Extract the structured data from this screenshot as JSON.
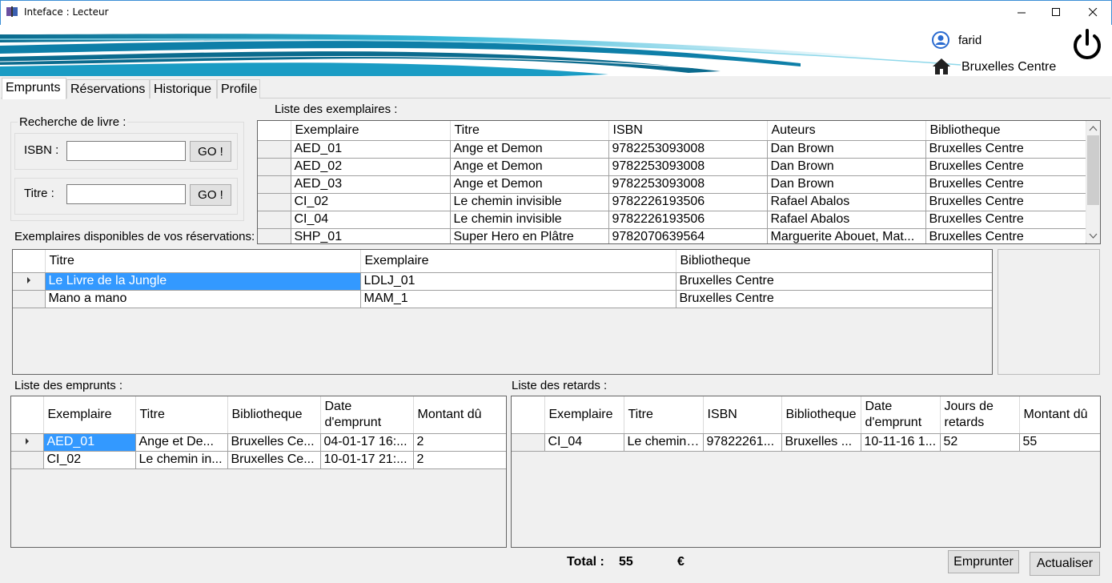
{
  "window": {
    "title": "Inteface : Lecteur"
  },
  "header": {
    "user_name": "farid",
    "branch": "Bruxelles Centre"
  },
  "tabs": [
    {
      "label": "Emprunts",
      "active": true
    },
    {
      "label": "Réservations"
    },
    {
      "label": "Historique"
    },
    {
      "label": "Profile"
    }
  ],
  "search": {
    "legend": "Recherche de livre :",
    "isbn_label": "ISBN :",
    "isbn_value": "",
    "title_label": "Titre :",
    "title_value": "",
    "go_label": "GO !"
  },
  "copies": {
    "label": "Liste des exemplaires :",
    "columns": [
      "Exemplaire",
      "Titre",
      "ISBN",
      "Auteurs",
      "Bibliotheque"
    ],
    "rows": [
      [
        "AED_01",
        "Ange et Demon",
        "9782253093008",
        "Dan Brown",
        "Bruxelles Centre"
      ],
      [
        "AED_02",
        "Ange et Demon",
        "9782253093008",
        "Dan Brown",
        "Bruxelles Centre"
      ],
      [
        "AED_03",
        "Ange et Demon",
        "9782253093008",
        "Dan Brown",
        "Bruxelles Centre"
      ],
      [
        "CI_02",
        "Le chemin invisible",
        "9782226193506",
        "Rafael Abalos",
        "Bruxelles Centre"
      ],
      [
        "CI_04",
        "Le chemin invisible",
        "9782226193506",
        "Rafael Abalos",
        "Bruxelles Centre"
      ],
      [
        "SHP_01",
        "Super Hero en Plâtre",
        "9782070639564",
        "Marguerite Abouet, Mat...",
        "Bruxelles Centre"
      ]
    ]
  },
  "reservations": {
    "label": "Exemplaires disponibles de vos réservations:",
    "columns": [
      "Titre",
      "Exemplaire",
      "Bibliotheque"
    ],
    "rows": [
      [
        "Le Livre de la Jungle",
        "LDLJ_01",
        "Bruxelles Centre"
      ],
      [
        "Mano a mano",
        "MAM_1",
        "Bruxelles Centre"
      ]
    ]
  },
  "loans": {
    "label": "Liste des emprunts :",
    "columns": [
      "Exemplaire",
      "Titre",
      "Bibliotheque",
      "Date d'emprunt",
      "Montant dû"
    ],
    "rows": [
      [
        "AED_01",
        "Ange et De...",
        "Bruxelles Ce...",
        "04-01-17 16:...",
        "2"
      ],
      [
        "CI_02",
        "Le chemin in...",
        "Bruxelles Ce...",
        "10-01-17 21:...",
        "2"
      ]
    ]
  },
  "late": {
    "label": "Liste des retards :",
    "columns": [
      "Exemplaire",
      "Titre",
      "ISBN",
      "Bibliotheque",
      "Date d'emprunt",
      "Jours de retards",
      "Montant dû"
    ],
    "rows": [
      [
        "CI_04",
        "Le chemin ...",
        "97822261...",
        "Bruxelles ...",
        "10-11-16 1...",
        "52",
        "55"
      ]
    ]
  },
  "footer": {
    "total_label": "Total :",
    "total_value": "55",
    "currency": "€",
    "borrow_label": "Emprunter",
    "refresh_label": "Actualiser"
  },
  "colors": {
    "selection": "#3399ff",
    "banner_dark": "#0b6b8e",
    "banner_light": "#36b7d8"
  }
}
